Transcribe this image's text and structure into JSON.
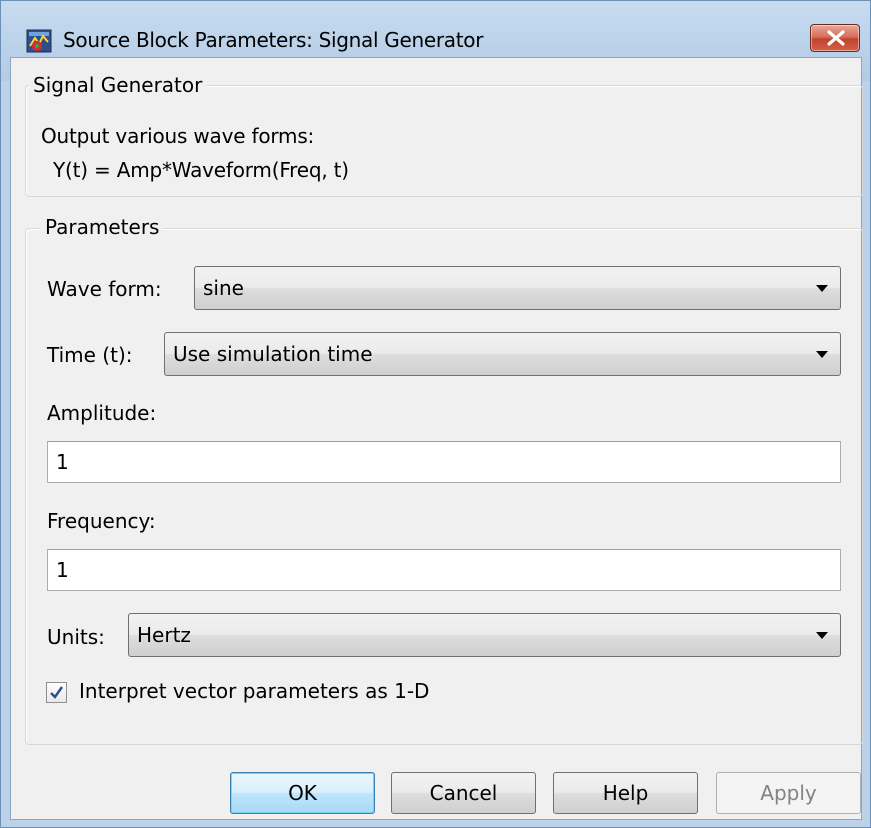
{
  "window": {
    "title": "Source Block Parameters: Signal Generator",
    "close_icon": "close-icon",
    "app_icon": "simulink-block-icon"
  },
  "block_group": {
    "label": "Signal Generator",
    "description_line1": "Output various wave forms:",
    "description_line2": "Y(t) = Amp*Waveform(Freq, t)"
  },
  "parameters_group": {
    "label": "Parameters",
    "wave_form": {
      "label": "Wave form:",
      "value": "sine"
    },
    "time": {
      "label": "Time (t):",
      "value": "Use simulation time"
    },
    "amplitude": {
      "label": "Amplitude:",
      "value": "1"
    },
    "frequency": {
      "label": "Frequency:",
      "value": "1"
    },
    "units": {
      "label": "Units:",
      "value": "Hertz"
    },
    "interpret_vector": {
      "label": "Interpret vector parameters as 1-D",
      "checked": true
    }
  },
  "buttons": {
    "ok": "OK",
    "cancel": "Cancel",
    "help": "Help",
    "apply": "Apply"
  },
  "colors": {
    "accent": "#3c7fb1",
    "close_red": "#c2432b",
    "disabled_text": "#838383"
  }
}
